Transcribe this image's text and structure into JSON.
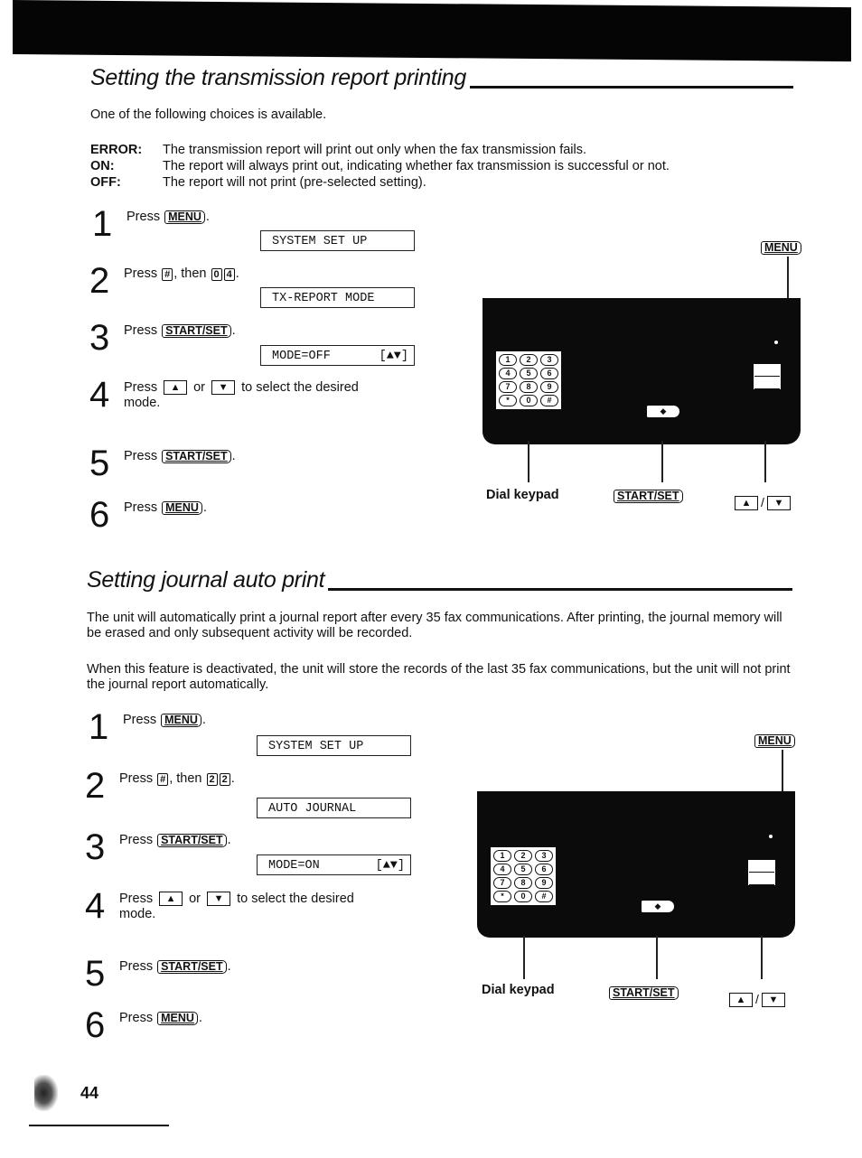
{
  "section1": {
    "title": "Setting the transmission report printing",
    "intro": "One of the following choices is available.",
    "choices": [
      {
        "key": "ERROR:",
        "desc": "The transmission report will print out only when the fax transmission fails."
      },
      {
        "key": "ON:",
        "desc": "The report will always print out, indicating whether fax transmission is successful or not."
      },
      {
        "key": "OFF:",
        "desc": "The report will not print (pre-selected setting)."
      }
    ],
    "steps": [
      {
        "num": "1",
        "pre": "Press ",
        "key": "MENU",
        "post": "."
      },
      {
        "num": "2",
        "pre": "Press ",
        "key1": "#",
        "mid": ", then ",
        "key2": "0",
        "key3": "4",
        "post": "."
      },
      {
        "num": "3",
        "pre": "Press ",
        "key": "START/SET",
        "post": "."
      },
      {
        "num": "4",
        "pre": "Press ",
        "up": "▲",
        "or": " or ",
        "down": "▼",
        "post": " to select the desired",
        "post2": "mode."
      },
      {
        "num": "5",
        "pre": "Press ",
        "key": "START/SET",
        "post": "."
      },
      {
        "num": "6",
        "pre": "Press ",
        "key": "MENU",
        "post": "."
      }
    ],
    "displays": [
      "SYSTEM SET UP",
      "TX-REPORT MODE",
      "MODE=OFF"
    ],
    "display_tail": "[▲▼]",
    "diagram": {
      "menu_label": "MENU",
      "dial_keypad_label": "Dial keypad",
      "start_set_label": "START/SET",
      "arrow_up": "▲",
      "arrow_sep": "/",
      "arrow_down": "▼"
    }
  },
  "section2": {
    "title": "Setting journal auto print",
    "para1": "The unit will automatically print a journal report after every 35 fax communications. After printing, the journal memory will be erased and only subsequent activity will be recorded.",
    "para2": "When this feature is deactivated, the unit will store the records of the last 35 fax communications, but the unit will not print the journal report automatically.",
    "steps": [
      {
        "num": "1",
        "pre": "Press ",
        "key": "MENU",
        "post": "."
      },
      {
        "num": "2",
        "pre": "Press ",
        "key1": "#",
        "mid": ", then ",
        "key2": "2",
        "key3": "2",
        "post": "."
      },
      {
        "num": "3",
        "pre": "Press ",
        "key": "START/SET",
        "post": "."
      },
      {
        "num": "4",
        "pre": "Press ",
        "up": "▲",
        "or": " or ",
        "down": "▼",
        "post": " to select the desired",
        "post2": "mode."
      },
      {
        "num": "5",
        "pre": "Press ",
        "key": "START/SET",
        "post": "."
      },
      {
        "num": "6",
        "pre": "Press ",
        "key": "MENU",
        "post": "."
      }
    ],
    "displays": [
      "SYSTEM SET UP",
      "AUTO JOURNAL",
      "MODE=ON"
    ],
    "display_tail": "[▲▼]",
    "diagram": {
      "menu_label": "MENU",
      "dial_keypad_label": "Dial keypad",
      "start_set_label": "START/SET",
      "arrow_up": "▲",
      "arrow_sep": "/",
      "arrow_down": "▼"
    }
  },
  "keypad_keys": [
    "1",
    "2",
    "3",
    "4",
    "5",
    "6",
    "7",
    "8",
    "9",
    "*",
    "0",
    "#"
  ],
  "page_number": "44"
}
